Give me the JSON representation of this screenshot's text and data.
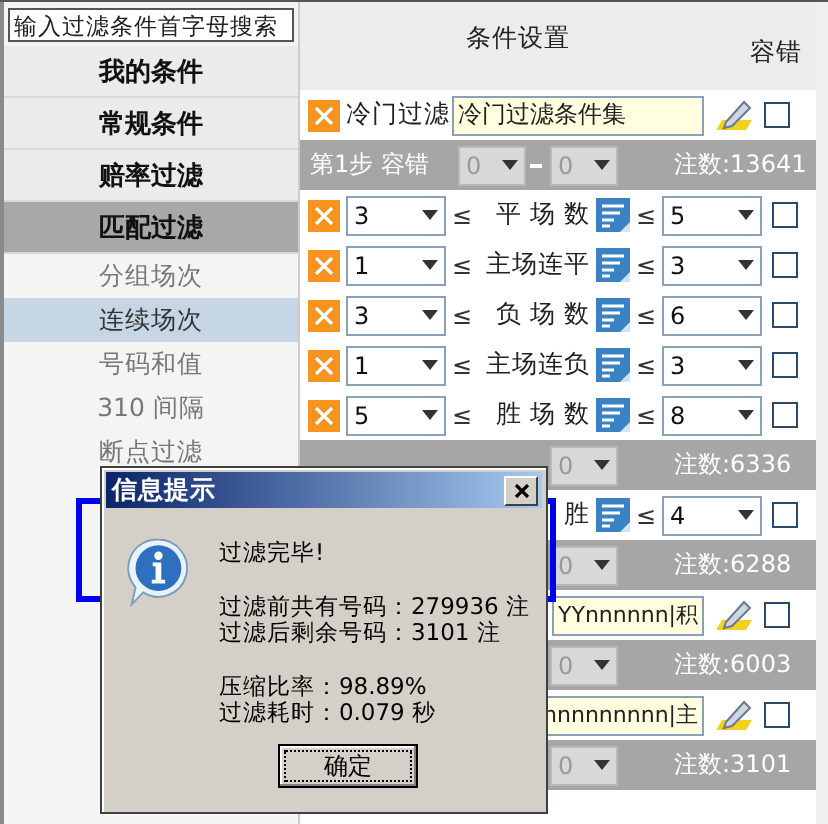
{
  "sidebar": {
    "search": {
      "placeholder": "输入过滤条件首字母搜索"
    },
    "items": [
      {
        "label": "我的条件",
        "kind": "group",
        "selected": false
      },
      {
        "label": "常规条件",
        "kind": "group",
        "selected": false
      },
      {
        "label": "赔率过滤",
        "kind": "group",
        "selected": false
      },
      {
        "label": "匹配过滤",
        "kind": "group",
        "selected": true
      },
      {
        "label": "分组场次",
        "kind": "sub",
        "selected": false
      },
      {
        "label": "连续场次",
        "kind": "sub",
        "selected": true
      },
      {
        "label": "号码和值",
        "kind": "sub",
        "selected": false
      },
      {
        "label": "310 间隔",
        "kind": "sub",
        "selected": false
      },
      {
        "label": "断点过滤",
        "kind": "sub",
        "selected": false
      }
    ]
  },
  "panel": {
    "columns": [
      "条件设置",
      "容错"
    ],
    "rows": [
      {
        "kind": "name",
        "label": "冷门过滤",
        "value": "冷门过滤条件集",
        "tolerance": false
      },
      {
        "kind": "step",
        "label": "第1步 容错",
        "from": "0",
        "to": "0",
        "count": "注数:13641"
      },
      {
        "kind": "range",
        "min": "3",
        "lower_op": "≤",
        "label": "平 场 数",
        "upper_op": "≤",
        "max": "5",
        "tolerance": false
      },
      {
        "kind": "range",
        "min": "1",
        "lower_op": "≤",
        "label": "主场连平",
        "upper_op": "≤",
        "max": "3",
        "tolerance": false
      },
      {
        "kind": "range",
        "min": "3",
        "lower_op": "≤",
        "label": "负 场 数",
        "upper_op": "≤",
        "max": "6",
        "tolerance": false
      },
      {
        "kind": "range",
        "min": "1",
        "lower_op": "≤",
        "label": "主场连负",
        "upper_op": "≤",
        "max": "3",
        "tolerance": false
      },
      {
        "kind": "range",
        "min": "5",
        "lower_op": "≤",
        "label": "胜 场 数",
        "upper_op": "≤",
        "max": "8",
        "tolerance": false
      },
      {
        "kind": "step",
        "to": "0",
        "count": "注数:6336"
      },
      {
        "kind": "range",
        "label": "胜",
        "upper_op": "≤",
        "max": "4",
        "tolerance": false
      },
      {
        "kind": "step",
        "to": "0",
        "count": "注数:6288"
      },
      {
        "kind": "name",
        "value": "YYnnnnnn|积",
        "tolerance": false
      },
      {
        "kind": "step",
        "to": "0",
        "count": "注数:6003"
      },
      {
        "kind": "name",
        "value": "nnnnnnnnn|主",
        "tolerance": false
      },
      {
        "kind": "step",
        "to": "0",
        "count": "注数:3101"
      }
    ]
  },
  "dialog": {
    "title": "信息提示",
    "groups": [
      [
        "过滤完毕!"
      ],
      [
        "过滤前共有号码：279936 注",
        "过滤后剩余号码：3101 注"
      ],
      [
        "压缩比率：98.89%",
        "过滤耗时：0.079 秒"
      ]
    ],
    "button": "确定"
  }
}
